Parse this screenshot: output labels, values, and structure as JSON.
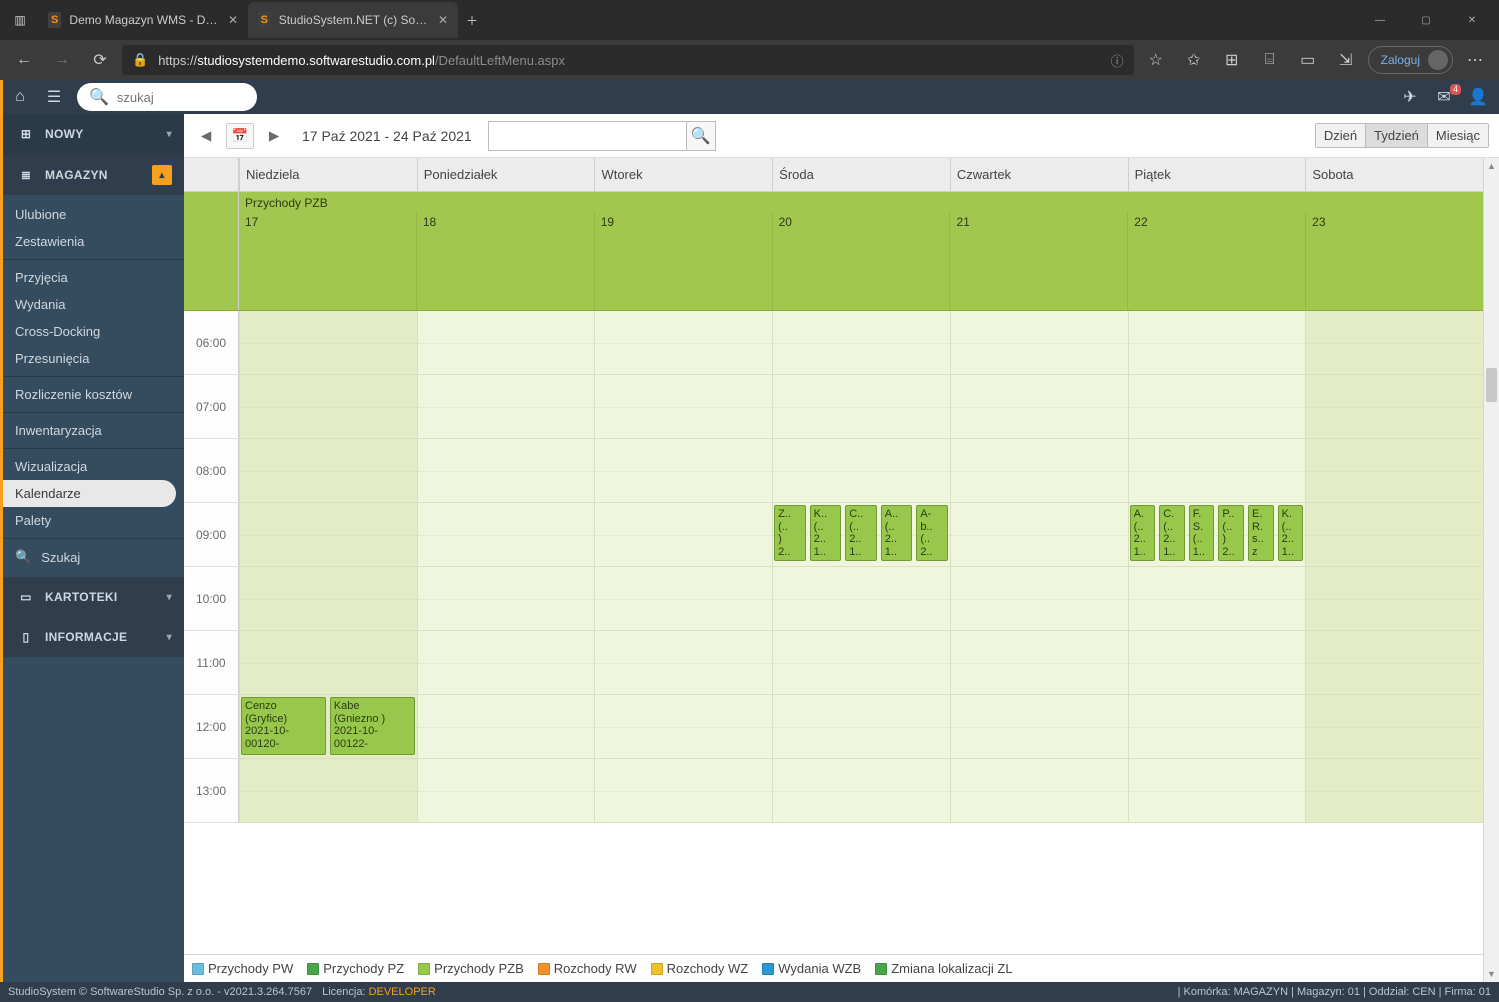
{
  "browser": {
    "tabs": [
      {
        "title": "Demo Magazyn WMS - Demo o..."
      },
      {
        "title": "StudioSystem.NET (c) SoftwareSt..."
      }
    ],
    "url_prefix": "https://",
    "url_host": "studiosystemdemo.softwarestudio.com.pl",
    "url_path": "/DefaultLeftMenu.aspx",
    "login": "Zaloguj"
  },
  "header": {
    "search_placeholder": "szukaj",
    "mail_badge": "4"
  },
  "sidebar": {
    "nowy": "NOWY",
    "magazyn": "MAGAZYN",
    "kartoteki": "KARTOTEKI",
    "informacje": "INFORMACJE",
    "szukaj": "Szukaj",
    "items_a": [
      "Ulubione",
      "Zestawienia"
    ],
    "items_b": [
      "Przyjęcia",
      "Wydania",
      "Cross-Docking",
      "Przesunięcia"
    ],
    "items_c": [
      "Rozliczenie kosztów"
    ],
    "items_d": [
      "Inwentaryzacja"
    ],
    "items_e": [
      "Wizualizacja",
      "Kalendarze",
      "Palety"
    ]
  },
  "calendar": {
    "range": "17 Paź 2021 - 24 Paź 2021",
    "views": {
      "day": "Dzień",
      "week": "Tydzień",
      "month": "Miesiąc"
    },
    "dayLabels": [
      "Niedziela",
      "Poniedziałek",
      "Wtorek",
      "Środa",
      "Czwartek",
      "Piątek",
      "Sobota"
    ],
    "alldayTitle": "Przychody PZB",
    "dates": [
      "17",
      "18",
      "19",
      "20",
      "21",
      "22",
      "23"
    ],
    "hours": [
      "06:00",
      "07:00",
      "08:00",
      "09:00",
      "10:00",
      "11:00",
      "12:00",
      "13:00"
    ],
    "events_sunday_12": [
      {
        "lines": [
          "Cenzo",
          "(Gryfice)",
          "2021-10-",
          "00120-"
        ]
      },
      {
        "lines": [
          "Kabe",
          "(Gniezno )",
          "2021-10-",
          "00122-"
        ]
      }
    ],
    "events_wed_9": [
      {
        "lines": [
          "Z..",
          "(..",
          ")",
          "2.."
        ]
      },
      {
        "lines": [
          "K..",
          "(..",
          "2..",
          "1.."
        ]
      },
      {
        "lines": [
          "C..",
          "(..",
          "2..",
          "1.."
        ]
      },
      {
        "lines": [
          "A..",
          "(..",
          "2..",
          "1.."
        ]
      },
      {
        "lines": [
          "A-",
          "b..",
          "(..",
          "2.."
        ]
      }
    ],
    "events_fri_9": [
      {
        "lines": [
          "A.",
          "(..",
          "2..",
          "1.."
        ]
      },
      {
        "lines": [
          "C.",
          "(..",
          "2..",
          "1.."
        ]
      },
      {
        "lines": [
          "F.",
          "S.",
          "(..",
          "1.."
        ]
      },
      {
        "lines": [
          "P..",
          "(..",
          ")",
          "2.."
        ]
      },
      {
        "lines": [
          "E.",
          "R.",
          "s..",
          "z"
        ]
      },
      {
        "lines": [
          "K.",
          "(..",
          "2..",
          "1.."
        ]
      }
    ]
  },
  "legend": [
    {
      "label": "Przychody PW",
      "color": "#6bbde0"
    },
    {
      "label": "Przychody PZ",
      "color": "#4aa64a"
    },
    {
      "label": "Przychody PZB",
      "color": "#98c84b"
    },
    {
      "label": "Rozchody RW",
      "color": "#f0902b"
    },
    {
      "label": "Rozchody WZ",
      "color": "#f0c12b"
    },
    {
      "label": "Wydania WZB",
      "color": "#2b98d0"
    },
    {
      "label": "Zmiana lokalizacji ZL",
      "color": "#4aa64a"
    }
  ],
  "status": {
    "left1": "StudioSystem © SoftwareStudio Sp. z o.o. - v2021.3.264.7567",
    "left2_label": "Licencja:",
    "left2_value": "DEVELOPER",
    "right": "| Komórka: MAGAZYN | Magazyn: 01 | Oddział: CEN | Firma: 01"
  }
}
